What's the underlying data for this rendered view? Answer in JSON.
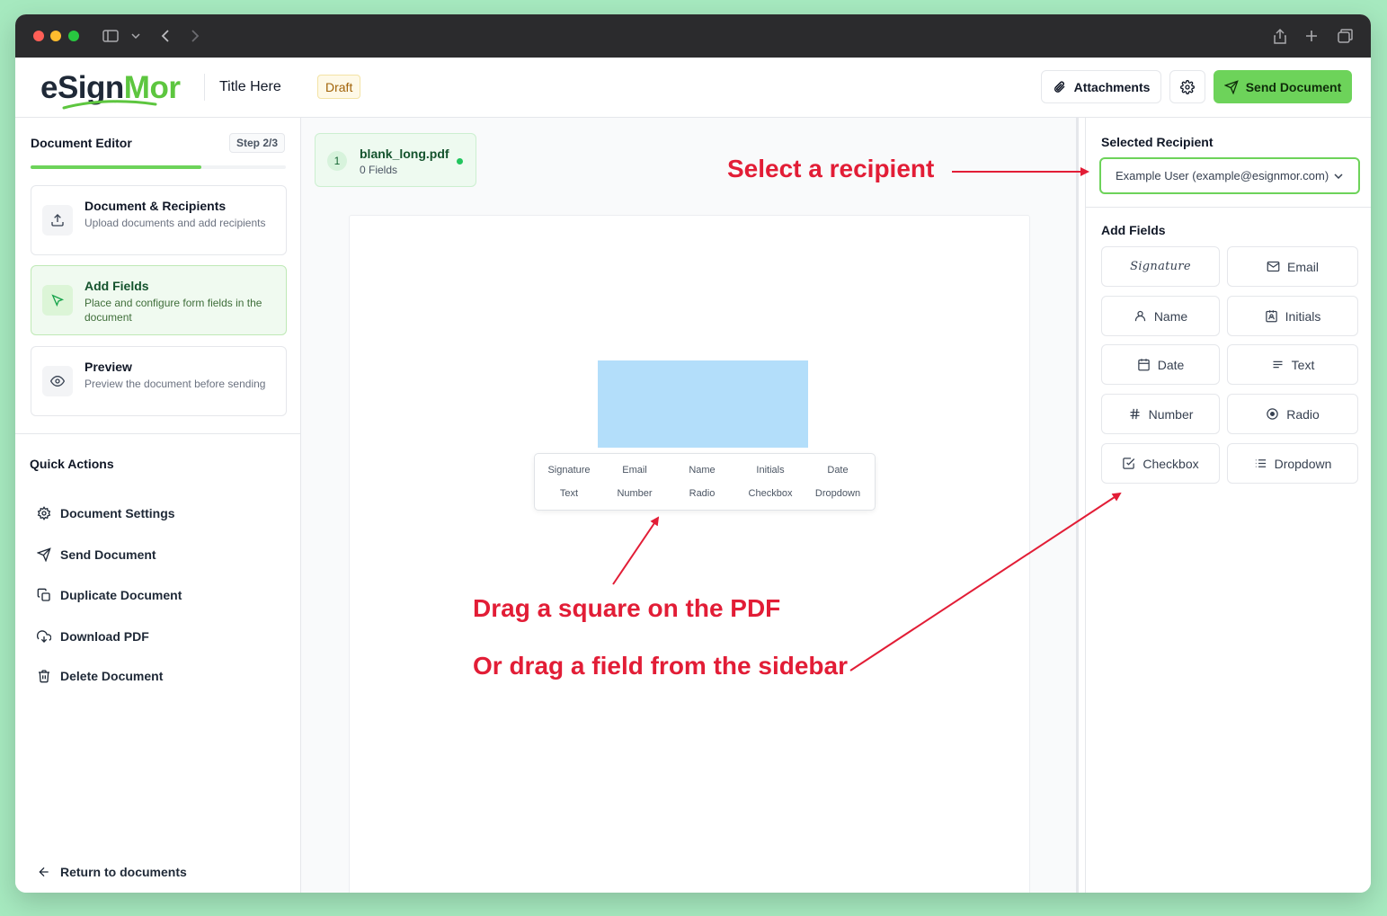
{
  "app": {
    "logo": {
      "part1": "eSign",
      "part2": "Mor"
    },
    "document_title": "Title Here",
    "status_badge": "Draft",
    "attachments_label": "Attachments",
    "send_label": "Send Document",
    "accent_color": "#6dd35a"
  },
  "left_panel": {
    "title": "Document Editor",
    "step_badge": "Step 2/3",
    "progress_fraction": 0.67,
    "steps": [
      {
        "title": "Document & Recipients",
        "desc": "Upload documents and add recipients",
        "icon": "upload-icon"
      },
      {
        "title": "Add Fields",
        "desc": "Place and configure form fields in the document",
        "icon": "cursor-icon",
        "active": true
      },
      {
        "title": "Preview",
        "desc": "Preview the document before sending",
        "icon": "eye-icon"
      }
    ],
    "quick_actions_title": "Quick Actions",
    "quick_actions": [
      {
        "label": "Document Settings",
        "icon": "gear-icon"
      },
      {
        "label": "Send Document",
        "icon": "send-icon"
      },
      {
        "label": "Duplicate Document",
        "icon": "copy-icon"
      },
      {
        "label": "Download PDF",
        "icon": "cloud-download-icon"
      },
      {
        "label": "Delete Document",
        "icon": "trash-icon"
      }
    ],
    "return_label": "Return to documents"
  },
  "canvas": {
    "file": {
      "index": "1",
      "name": "blank_long.pdf",
      "fields": "0 Fields"
    },
    "popup_fields": [
      [
        "Signature",
        "Email",
        "Name",
        "Initials",
        "Date"
      ],
      [
        "Text",
        "Number",
        "Radio",
        "Checkbox",
        "Dropdown"
      ]
    ]
  },
  "right_panel": {
    "selected_recipient_title": "Selected Recipient",
    "recipient_value": "Example User (example@esignmor.com)",
    "add_fields_title": "Add Fields",
    "fields": [
      {
        "label": "Signature",
        "icon": "signature-icon"
      },
      {
        "label": "Email",
        "icon": "mail-icon"
      },
      {
        "label": "Name",
        "icon": "user-icon"
      },
      {
        "label": "Initials",
        "icon": "badge-icon"
      },
      {
        "label": "Date",
        "icon": "calendar-icon"
      },
      {
        "label": "Text",
        "icon": "text-icon"
      },
      {
        "label": "Number",
        "icon": "hash-icon"
      },
      {
        "label": "Radio",
        "icon": "radio-icon"
      },
      {
        "label": "Checkbox",
        "icon": "checkbox-icon"
      },
      {
        "label": "Dropdown",
        "icon": "list-icon"
      }
    ]
  },
  "annotations": {
    "select_recipient": "Select a recipient",
    "drag_square": "Drag a square on the PDF",
    "drag_field": "Or drag a field from the sidebar",
    "color": "#e21d36"
  }
}
